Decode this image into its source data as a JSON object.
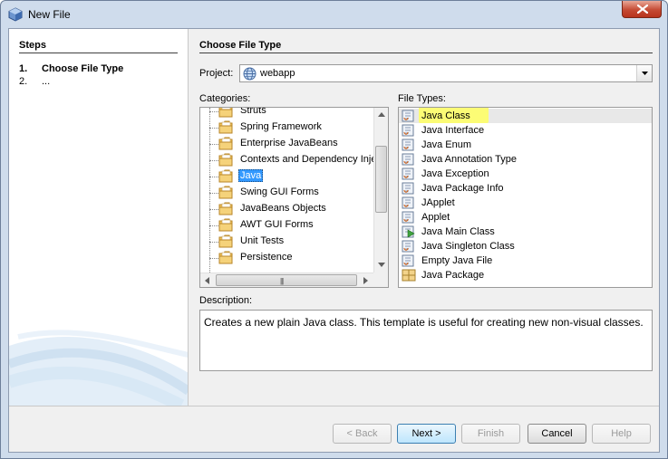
{
  "window": {
    "title": "New File",
    "close_label": "Close"
  },
  "steps": {
    "title": "Steps",
    "items": [
      {
        "num": "1.",
        "label": "Choose File Type"
      },
      {
        "num": "2.",
        "label": "..."
      }
    ]
  },
  "main": {
    "title": "Choose File Type",
    "project_label": "Project:",
    "project_value": "webapp",
    "categories_label": "Categories:",
    "file_types_label": "File Types:",
    "description_label": "Description:",
    "description_text": "Creates a new plain Java class. This template is useful for creating new non-visual classes."
  },
  "categories": [
    {
      "label": "Struts",
      "selected": false
    },
    {
      "label": "Spring Framework",
      "selected": false
    },
    {
      "label": "Enterprise JavaBeans",
      "selected": false
    },
    {
      "label": "Contexts and Dependency Inje",
      "selected": false
    },
    {
      "label": "Java",
      "selected": true
    },
    {
      "label": "Swing GUI Forms",
      "selected": false
    },
    {
      "label": "JavaBeans Objects",
      "selected": false
    },
    {
      "label": "AWT GUI Forms",
      "selected": false
    },
    {
      "label": "Unit Tests",
      "selected": false
    },
    {
      "label": "Persistence",
      "selected": false
    }
  ],
  "file_types": [
    {
      "label": "Java Class",
      "icon": "java-class-icon",
      "selected": true
    },
    {
      "label": "Java Interface",
      "icon": "java-class-icon",
      "selected": false
    },
    {
      "label": "Java Enum",
      "icon": "java-class-icon",
      "selected": false
    },
    {
      "label": "Java Annotation Type",
      "icon": "java-class-icon",
      "selected": false
    },
    {
      "label": "Java Exception",
      "icon": "java-class-icon",
      "selected": false
    },
    {
      "label": "Java Package Info",
      "icon": "java-class-icon",
      "selected": false
    },
    {
      "label": "JApplet",
      "icon": "java-class-icon",
      "selected": false
    },
    {
      "label": "Applet",
      "icon": "java-class-icon",
      "selected": false
    },
    {
      "label": "Java Main Class",
      "icon": "java-main-class-icon",
      "selected": false
    },
    {
      "label": "Java Singleton Class",
      "icon": "java-class-icon",
      "selected": false
    },
    {
      "label": "Empty Java File",
      "icon": "java-class-icon",
      "selected": false
    },
    {
      "label": "Java Package",
      "icon": "java-package-icon",
      "selected": false
    }
  ],
  "buttons": {
    "back": "< Back",
    "next": "Next >",
    "finish": "Finish",
    "cancel": "Cancel",
    "help": "Help"
  },
  "colors": {
    "selection": "#3399ff",
    "highlight": "#ffff60",
    "window_frame": "#cfdcec"
  }
}
